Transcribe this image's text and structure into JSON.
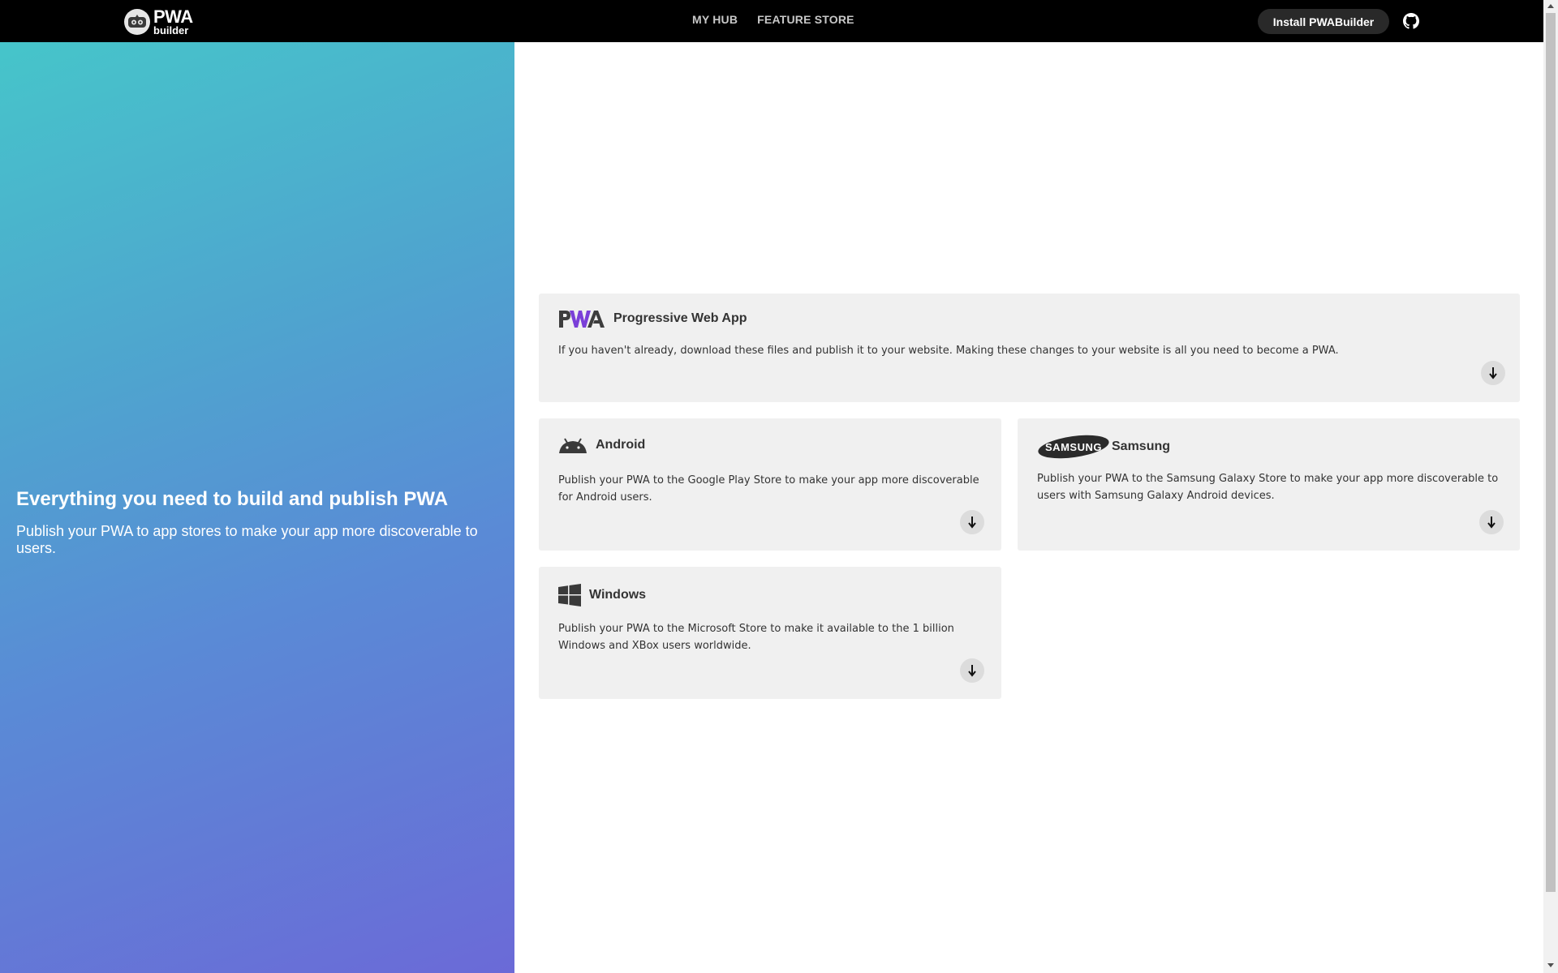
{
  "header": {
    "logo_pwa": "PWA",
    "logo_builder": "builder",
    "nav": [
      {
        "label": "MY HUB"
      },
      {
        "label": "FEATURE STORE"
      }
    ],
    "install_label": "Install PWABuilder",
    "github_icon": "github-icon"
  },
  "hero": {
    "title": "Everything you need to build and publish PWA",
    "subtitle": "Publish your PWA to app stores to make your app more discoverable to users."
  },
  "cards": {
    "pwa": {
      "title": "Progressive Web App",
      "description": "If you haven't already, download these files and publish it to your website. Making these changes to your website is all you need to become a PWA.",
      "logo_text": "PWA"
    },
    "android": {
      "title": "Android",
      "description": "Publish your PWA to the Google Play Store to make your app more discoverable for Android users."
    },
    "samsung": {
      "title": "Samsung",
      "logo_text": "SAMSUNG",
      "description": "Publish your PWA to the Samsung Galaxy Store to make your app more discoverable to users with Samsung Galaxy Android devices."
    },
    "windows": {
      "title": "Windows",
      "description": "Publish your PWA to the Microsoft Store to make it available to the 1 billion Windows and XBox users worldwide."
    }
  },
  "colors": {
    "topbar": "#000000",
    "card_bg": "#f0f0f0",
    "pwa_accent": "#7a3fd8",
    "gradient_start": "#46c5ca",
    "gradient_end": "#6b6ad7"
  }
}
